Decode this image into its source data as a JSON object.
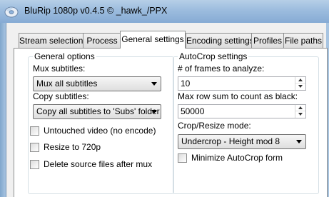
{
  "window": {
    "title": "BluRip 1080p v0.4.5 © _hawk_/PPX"
  },
  "tabs": [
    {
      "label": "Stream selection"
    },
    {
      "label": "Process"
    },
    {
      "label": "General settings"
    },
    {
      "label": "Encoding settings"
    },
    {
      "label": "Profiles"
    },
    {
      "label": "File paths"
    }
  ],
  "general_options": {
    "title": "General options",
    "mux_subtitles_label": "Mux subtitles:",
    "mux_subtitles_value": "Mux all subtitles",
    "copy_subtitles_label": "Copy subtitles:",
    "copy_subtitles_value": "Copy all subtitles to 'Subs' folder",
    "checkboxes": [
      {
        "label": "Untouched video (no encode)",
        "checked": false
      },
      {
        "label": "Resize to 720p",
        "checked": false
      },
      {
        "label": "Delete source files after mux",
        "checked": false
      }
    ]
  },
  "autocrop": {
    "title": "AutoCrop settings",
    "frames_label": "# of frames to analyze:",
    "frames_value": "10",
    "rowsum_label": "Max row sum to count as black:",
    "rowsum_value": "50000",
    "mode_label": "Crop/Resize mode:",
    "mode_value": "Undercrop - Height mod 8",
    "minimize_label": "Minimize AutoCrop form",
    "minimize_checked": false
  }
}
